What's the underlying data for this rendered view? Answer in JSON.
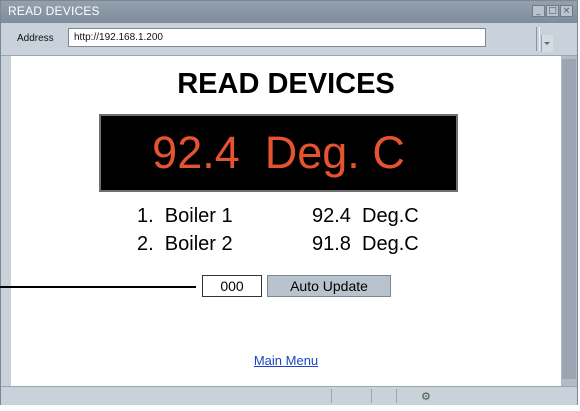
{
  "window": {
    "title": "READ DEVICES",
    "controls": {
      "minimize": "_",
      "maximize": "□",
      "close": "×"
    }
  },
  "address_bar": {
    "label": "Address",
    "url": "http://192.168.1.200"
  },
  "page": {
    "title": "READ DEVICES",
    "display": "92.4  Deg. C",
    "readings": [
      {
        "name": "1.  Boiler 1",
        "value": "92.4  Deg.C"
      },
      {
        "name": "2.  Boiler 2",
        "value": "91.8  Deg.C"
      }
    ],
    "code_value": "000",
    "auto_update_label": "Auto Update",
    "main_menu_link": "Main Menu"
  },
  "status_bar": {
    "icon": "network-icon"
  },
  "colors": {
    "display_text": "#e55330",
    "display_background": "#000000",
    "link": "#1a44c6",
    "chrome": "#c9d1da"
  }
}
